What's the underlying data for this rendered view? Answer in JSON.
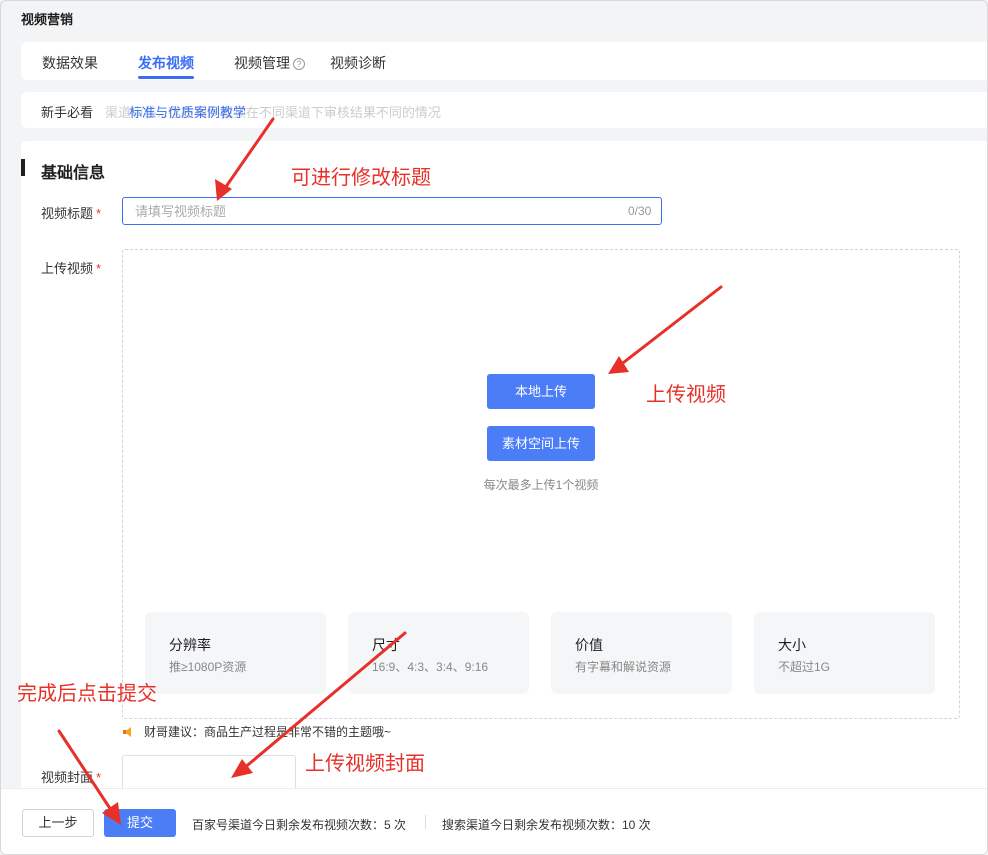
{
  "page": {
    "title": "视频营销"
  },
  "tabs": [
    {
      "label": "数据效果",
      "active": false
    },
    {
      "label": "发布视频",
      "active": true
    },
    {
      "label": "视频管理",
      "active": false
    },
    {
      "label": "视频诊断",
      "active": false
    }
  ],
  "tab_help_icon": "?",
  "notice": {
    "label": "新手必看",
    "link": "标准与优质案例教学",
    "ghost_text": "渠道审核...存在相同视频在不同渠道下审核结果不同的情况"
  },
  "section": {
    "title": "基础信息"
  },
  "form": {
    "title_label": "视频标题",
    "title_placeholder": "请填写视频标题",
    "title_counter": "0/30",
    "upload_label": "上传视频",
    "cover_label": "视频封面",
    "required_mark": "*"
  },
  "upload": {
    "local_button": "本地上传",
    "space_button": "素材空间上传",
    "hint": "每次最多上传1个视频"
  },
  "specs": [
    {
      "title": "分辨率",
      "desc": "推≥1080P资源"
    },
    {
      "title": "尺寸",
      "desc": "16:9、4:3、3:4、9:16"
    },
    {
      "title": "价值",
      "desc": "有字幕和解说资源"
    },
    {
      "title": "大小",
      "desc": "不超过1G"
    }
  ],
  "tip": "财哥建议：商品生产过程是非常不错的主题哦~",
  "footer": {
    "prev_button": "上一步",
    "submit_button": "提交",
    "baijiahao_quota": "百家号渠道今日剩余发布视频次数：5 次",
    "search_quota": "搜索渠道今日剩余发布视频次数：10 次"
  },
  "annotations": {
    "edit_title": "可进行修改标题",
    "upload_video": "上传视频",
    "upload_cover": "上传视频封面",
    "submit_after": "完成后点击提交"
  },
  "colors": {
    "primary": "#4b7df7",
    "annotation": "#e8302a",
    "link": "#3a6ff5"
  }
}
